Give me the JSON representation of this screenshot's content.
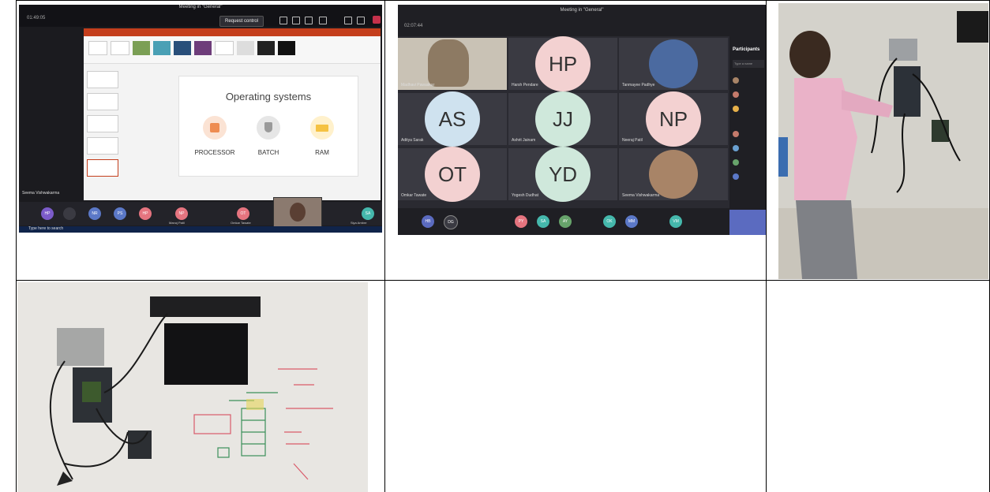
{
  "cell1": {
    "meeting_title": "Meeting in \"General\"",
    "time": "01:49:05",
    "request_control": "Request control",
    "slide_title": "Operating systems",
    "slide_labels": [
      "PROCESSOR",
      "BATCH",
      "RAM"
    ],
    "presenter_name": "Seema Vishwakarma",
    "taskbar_search": "Type here to search",
    "participants": [
      {
        "initials": "HP",
        "color": "#e5747f"
      },
      {
        "initials": "NR",
        "color": "#5b78c7"
      },
      {
        "initials": "PS",
        "color": "#5b78c7"
      },
      {
        "initials": "NP",
        "color": "#e5747f"
      },
      {
        "initials": "OT",
        "color": "#e5747f"
      },
      {
        "initials": "SA",
        "color": "#45b8ac"
      }
    ],
    "named_tiles": [
      "Manoj Patil",
      "Omkar Tawate",
      "Seema Vishwakarma",
      "Siya Ambre"
    ]
  },
  "cell2": {
    "meeting_title": "Meeting in \"General\"",
    "time": "02:07:44",
    "participants_header": "Participants",
    "search_placeholder": "Type a name",
    "tiles": [
      {
        "name": "Madhavi Pawaskar",
        "type": "photo",
        "color": "#8d7a63"
      },
      {
        "initials": "HP",
        "name": "Harsh Pendare",
        "color": "#f3d1d1"
      },
      {
        "name": "Tanmayee Padhye",
        "type": "photo",
        "color": "#4b6aa0"
      },
      {
        "initials": "AS",
        "name": "Aditya Sarak",
        "color": "#cfe2ef"
      },
      {
        "initials": "JJ",
        "name": "Ashrit Jainam",
        "color": "#cfe8db"
      },
      {
        "initials": "NP",
        "name": "Neeraj Patil",
        "color": "#f3d1d1"
      },
      {
        "initials": "OT",
        "name": "Omkar Tawate",
        "color": "#f3d1d1"
      },
      {
        "initials": "YD",
        "name": "Yogesh Dudhat",
        "color": "#cfe8db"
      },
      {
        "name": "Seema Vishwakarma",
        "type": "photo",
        "color": "#a88467"
      }
    ],
    "strip": [
      {
        "initials": "HB",
        "color": "#5b6bc0"
      },
      {
        "initials": "DG",
        "color": "#3a3a42"
      },
      {
        "initials": "PY",
        "color": "#e5747f"
      },
      {
        "initials": "SA",
        "color": "#45b8ac"
      },
      {
        "initials": "AY",
        "color": "#67a36b"
      },
      {
        "initials": "OK",
        "color": "#45b8ac"
      },
      {
        "initials": "MM",
        "color": "#5b78c7"
      },
      {
        "initials": "VM",
        "color": "#45b8ac"
      }
    ]
  }
}
